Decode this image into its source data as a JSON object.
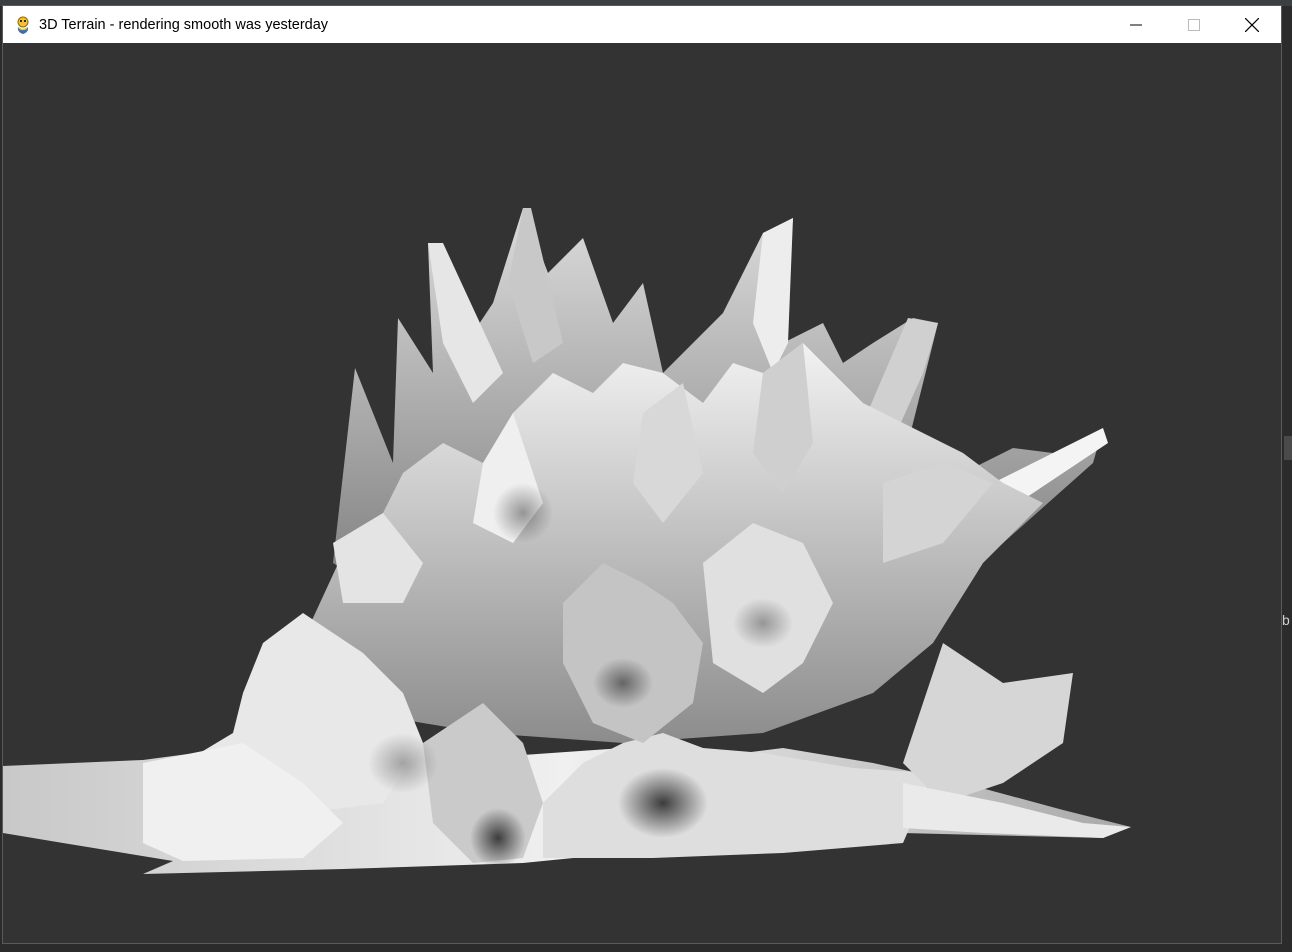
{
  "window": {
    "title": "3D Terrain - rendering smooth was yesterday",
    "icon": "pygame-snake-icon",
    "controls": [
      "minimize-icon",
      "maximize-icon",
      "close-icon"
    ]
  },
  "background_app": {
    "edge_letter": "b"
  },
  "colors": {
    "viewport_bg": "#333333",
    "titlebar_bg": "#ffffff",
    "terrain_light": "#f0f0f0",
    "terrain_dark": "#3a3a3a"
  }
}
